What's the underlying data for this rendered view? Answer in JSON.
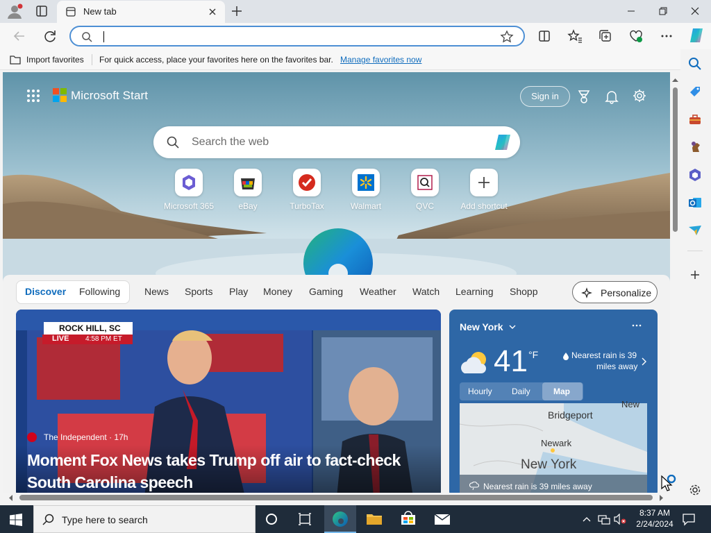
{
  "colors": {
    "accent": "#0f6cbd",
    "taskbar": "#1f2c3a",
    "weather_card": "#2e67a6"
  },
  "window": {
    "tab_title": "New tab",
    "controls": [
      "minimize-icon",
      "restore-icon",
      "close-icon"
    ]
  },
  "toolbar": {
    "address_value": "",
    "icons": [
      "back-icon",
      "refresh-icon",
      "favorite-star-icon",
      "split-screen-icon",
      "favorites-icon",
      "collections-icon",
      "performance-icon",
      "more-icon",
      "copilot-icon"
    ]
  },
  "favbar": {
    "import_label": "Import favorites",
    "message": "For quick access, place your favorites here on the favorites bar.",
    "manage_link": "Manage favorites now"
  },
  "sidebar": {
    "icons": [
      "search-icon",
      "shopping-tag-icon",
      "tools-icon",
      "games-icon",
      "microsoft365-icon",
      "outlook-icon",
      "send-icon",
      "add-icon",
      "settings-icon"
    ]
  },
  "start": {
    "brand": "Microsoft Start",
    "signin": "Sign in",
    "search_placeholder": "Search the web",
    "quick_links": [
      {
        "label": "Microsoft 365",
        "icon": "microsoft365-icon"
      },
      {
        "label": "eBay",
        "icon": "ebay-icon"
      },
      {
        "label": "TurboTax",
        "icon": "turbotax-icon"
      },
      {
        "label": "Walmart",
        "icon": "walmart-icon"
      },
      {
        "label": "QVC",
        "icon": "qvc-icon"
      },
      {
        "label": "Add shortcut",
        "icon": "plus-icon"
      }
    ]
  },
  "feed": {
    "tabs": [
      "Discover",
      "Following",
      "News",
      "Sports",
      "Play",
      "Money",
      "Gaming",
      "Weather",
      "Watch",
      "Learning",
      "Shopp"
    ],
    "personalize": "Personalize",
    "news": {
      "location_banner": "ROCK HILL, SC",
      "live": "LIVE",
      "time": "4:58 PM ET",
      "source": "The Independent · 17h",
      "headline_line1": "Moment Fox News takes Trump off air to fact-check",
      "headline_line2": "South Carolina speech"
    },
    "weather": {
      "city": "New York",
      "temp": "41",
      "unit": "°F",
      "rain_line1": "Nearest rain is 39",
      "rain_line2": "miles away",
      "tabs": [
        "Hourly",
        "Daily",
        "Map"
      ],
      "active_tab": "Map",
      "map_labels": [
        "Bridgeport",
        "Newark",
        "New York",
        "New"
      ],
      "map_footer": "Nearest rain is 39 miles away"
    }
  },
  "taskbar": {
    "search_placeholder": "Type here to search",
    "time": "8:37 AM",
    "date": "2/24/2024"
  }
}
